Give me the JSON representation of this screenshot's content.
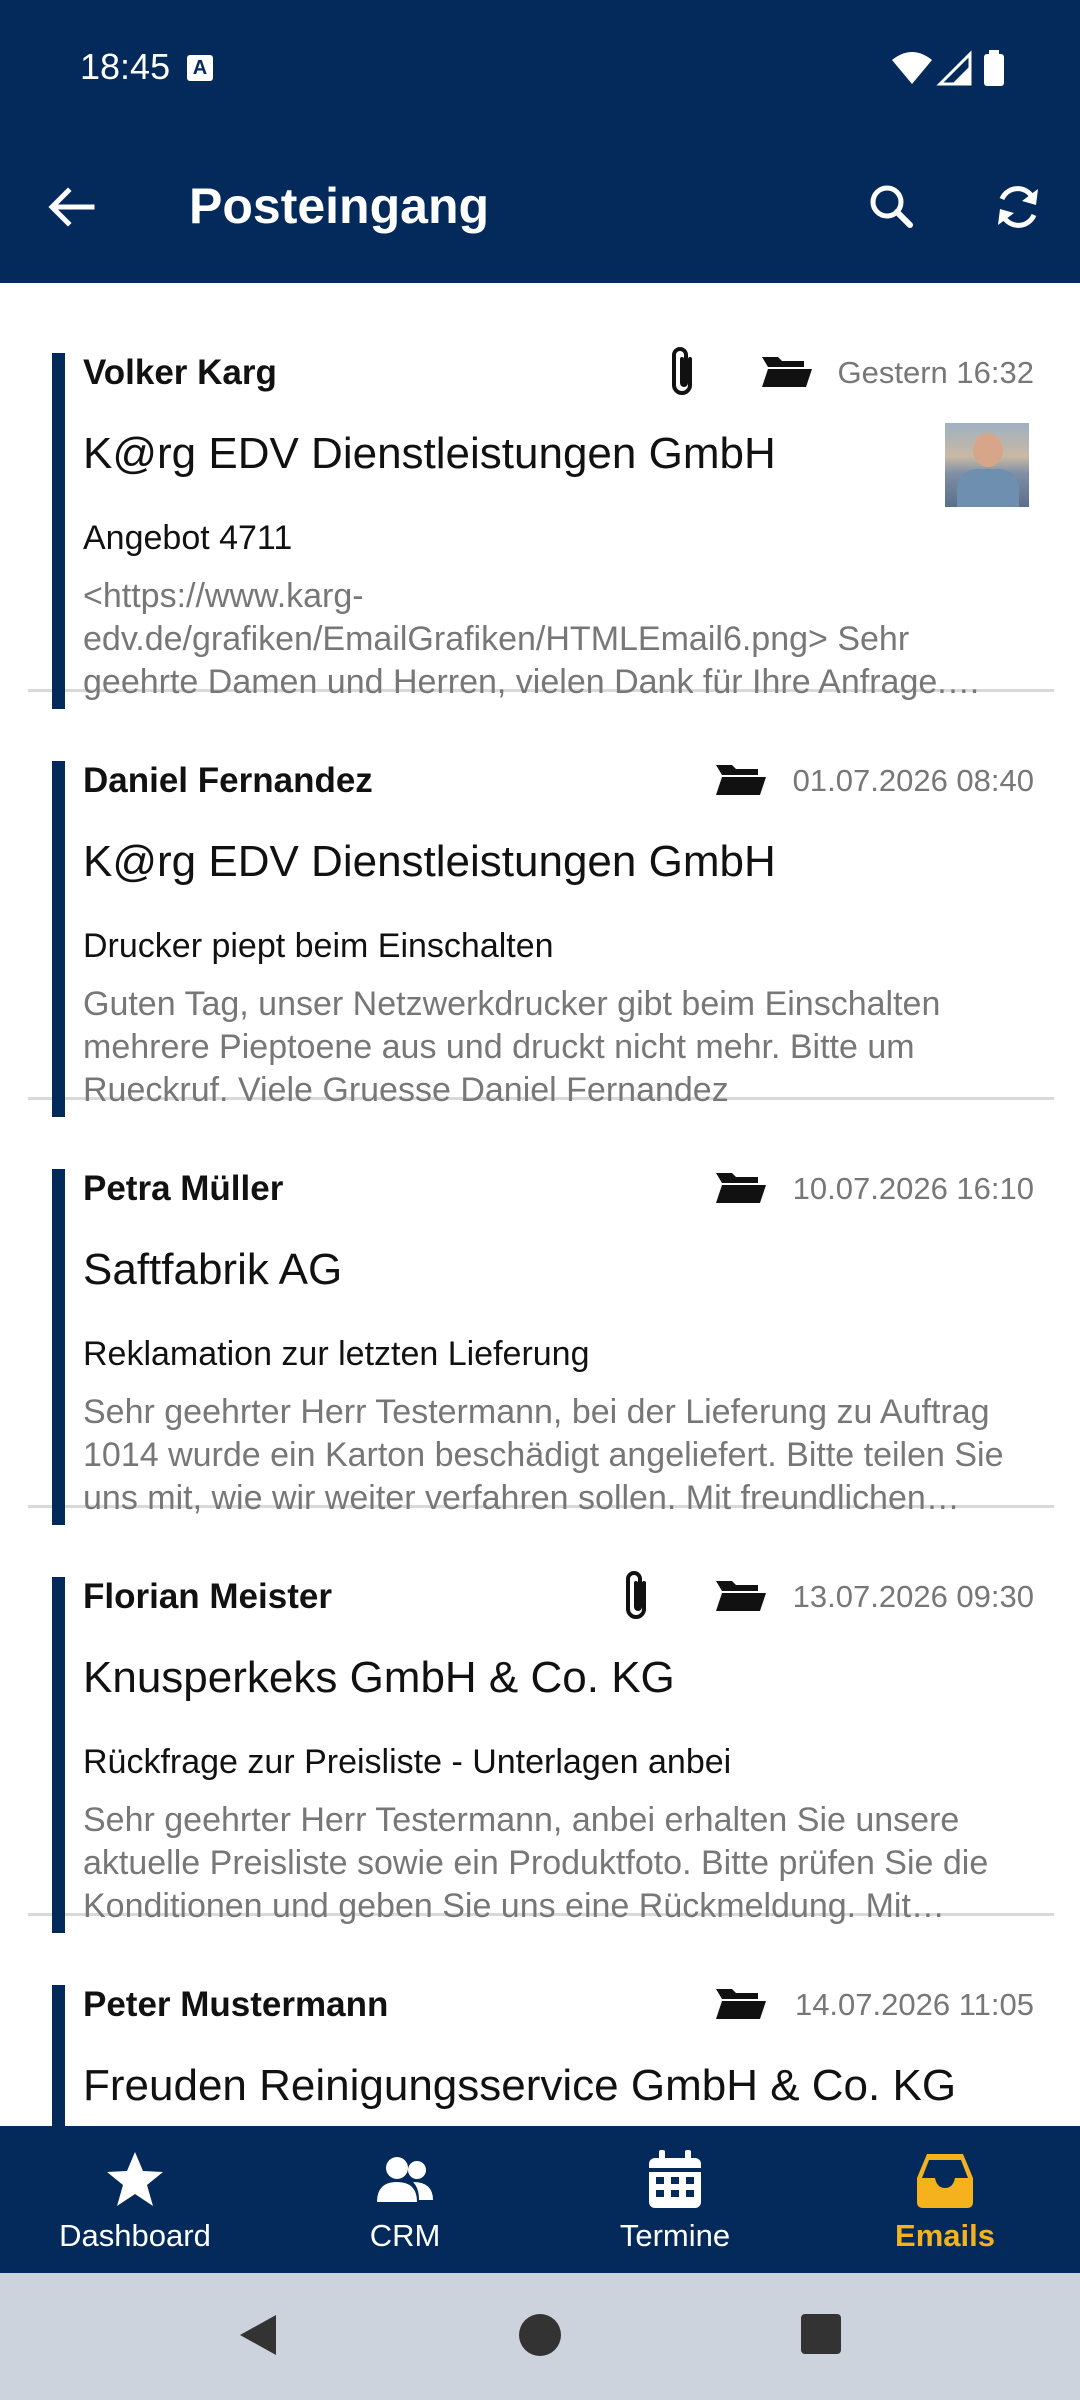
{
  "status_bar": {
    "time": "18:45",
    "a_badge": "A"
  },
  "app_bar": {
    "title": "Posteingang"
  },
  "emails": [
    {
      "sender": "Volker Karg",
      "date": "Gestern 16:32",
      "company": "K@rg EDV Dienstleistungen GmbH",
      "subject": "Angebot 4711",
      "preview": "<https://www.karg-edv.de/grafiken/EmailGrafiken/HTMLEmail6.png> Sehr geehrte Damen und Herren, vielen Dank für Ihre Anfrage. Anbei übersenden wir Ihnen unser Angebot.",
      "has_attachment": true,
      "has_avatar": true
    },
    {
      "sender": "Daniel Fernandez",
      "date": "01.07.2026 08:40",
      "company": "K@rg EDV Dienstleistungen GmbH",
      "subject": "Drucker piept beim Einschalten",
      "preview": "Guten Tag,  unser Netzwerkdrucker gibt beim Einschalten mehrere Pieptoene aus und druckt nicht mehr. Bitte um Rueckruf.  Viele Gruesse Daniel Fernandez",
      "has_attachment": false
    },
    {
      "sender": "Petra Müller",
      "date": "10.07.2026 16:10",
      "company": "Saftfabrik AG",
      "subject": "Reklamation zur letzten Lieferung",
      "preview": "Sehr geehrter Herr Testermann,  bei der Lieferung zu Auftrag 1014 wurde ein Karton beschädigt angeliefert. Bitte teilen Sie uns mit, wie wir weiter verfahren sollen.  Mit freundlichen Grüßen",
      "has_attachment": false
    },
    {
      "sender": "Florian Meister",
      "date": "13.07.2026 09:30",
      "company": "Knusperkeks GmbH & Co. KG",
      "subject": "Rückfrage zur Preisliste - Unterlagen anbei",
      "preview": "Sehr geehrter Herr Testermann,  anbei erhalten Sie unsere aktuelle Preisliste sowie ein Produktfoto. Bitte prüfen Sie die Konditionen und geben Sie uns eine Rückmeldung.  Mit freundlichen Grüßen",
      "has_attachment": true
    },
    {
      "sender": "Peter Mustermann",
      "date": "14.07.2026 11:05",
      "company": "Freuden Reinigungsservice GmbH & Co. KG",
      "subject": "",
      "preview": "",
      "has_attachment": false
    }
  ],
  "bottom_nav": [
    {
      "label": "Dashboard",
      "icon": "star-icon",
      "active": false
    },
    {
      "label": "CRM",
      "icon": "people-icon",
      "active": false
    },
    {
      "label": "Termine",
      "icon": "calendar-icon",
      "active": false
    },
    {
      "label": "Emails",
      "icon": "inbox-icon",
      "active": true
    }
  ],
  "colors": {
    "primary": "#042a5b",
    "accent": "#f5b21c",
    "muted_text": "#777777"
  }
}
